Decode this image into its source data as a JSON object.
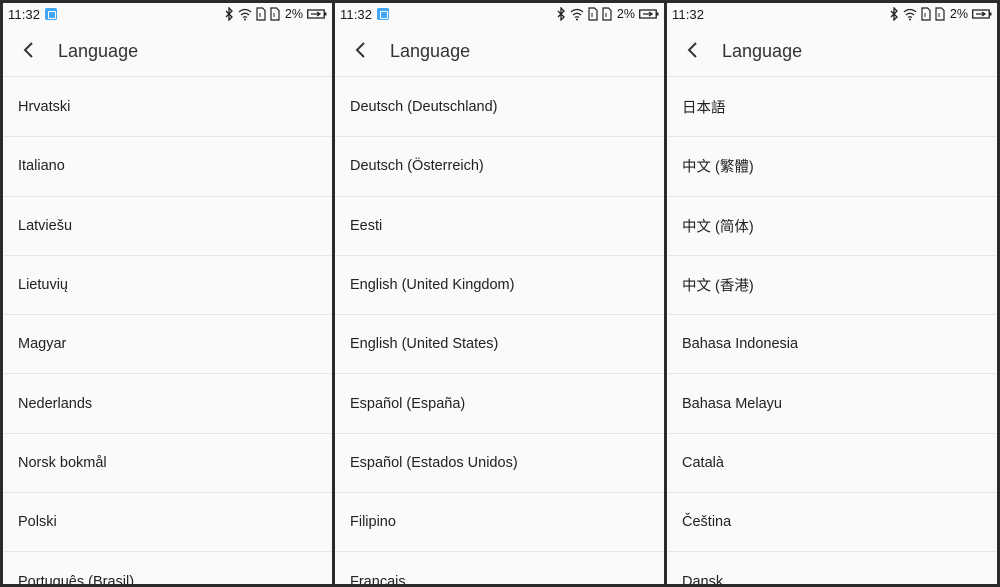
{
  "status": {
    "time": "11:32",
    "battery": "2%"
  },
  "screens": [
    {
      "title": "Language",
      "items": [
        "Hrvatski",
        "Italiano",
        "Latviešu",
        "Lietuvių",
        "Magyar",
        "Nederlands",
        "Norsk bokmål",
        "Polski",
        "Português (Brasil)"
      ]
    },
    {
      "title": "Language",
      "items": [
        "Deutsch (Deutschland)",
        "Deutsch (Österreich)",
        "Eesti",
        "English (United Kingdom)",
        "English (United States)",
        "Español (España)",
        "Español (Estados Unidos)",
        "Filipino",
        "Français"
      ]
    },
    {
      "title": "Language",
      "items": [
        "日本語",
        "中文 (繁體)",
        "中文 (简体)",
        "中文 (香港)",
        "Bahasa Indonesia",
        "Bahasa Melayu",
        "Català",
        "Čeština",
        "Dansk"
      ]
    }
  ]
}
